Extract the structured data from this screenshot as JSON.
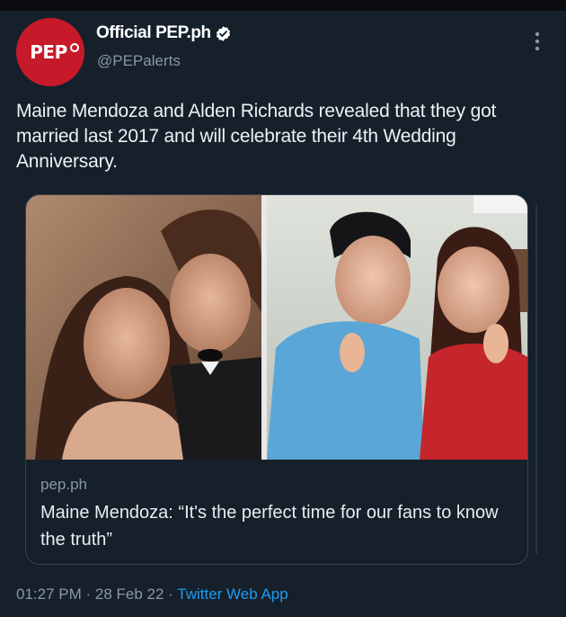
{
  "tweet": {
    "author": {
      "display_name": "Official PEP.ph",
      "handle": "@PEPalerts",
      "avatar_text": "PEP",
      "verified": true
    },
    "text": "Maine Mendoza and Alden Richards revealed that they got married last 2017 and will celebrate their 4th Wedding Anniversary.",
    "card": {
      "domain": "pep.ph",
      "title": "Maine Mendoza: “It's the perfect time for our fans to know the truth”"
    },
    "meta": {
      "time": "01:27 PM",
      "separator_1": " · ",
      "date": "28 Feb 22",
      "separator_2": " · ",
      "source": "Twitter Web App"
    }
  },
  "icons": {
    "verified": "verified-badge-icon",
    "more": "more-vertical-icon"
  },
  "colors": {
    "background": "#15202b",
    "accent": "#1d9bf0",
    "avatar": "#c61a2b",
    "secondary_text": "#8a96a3"
  }
}
